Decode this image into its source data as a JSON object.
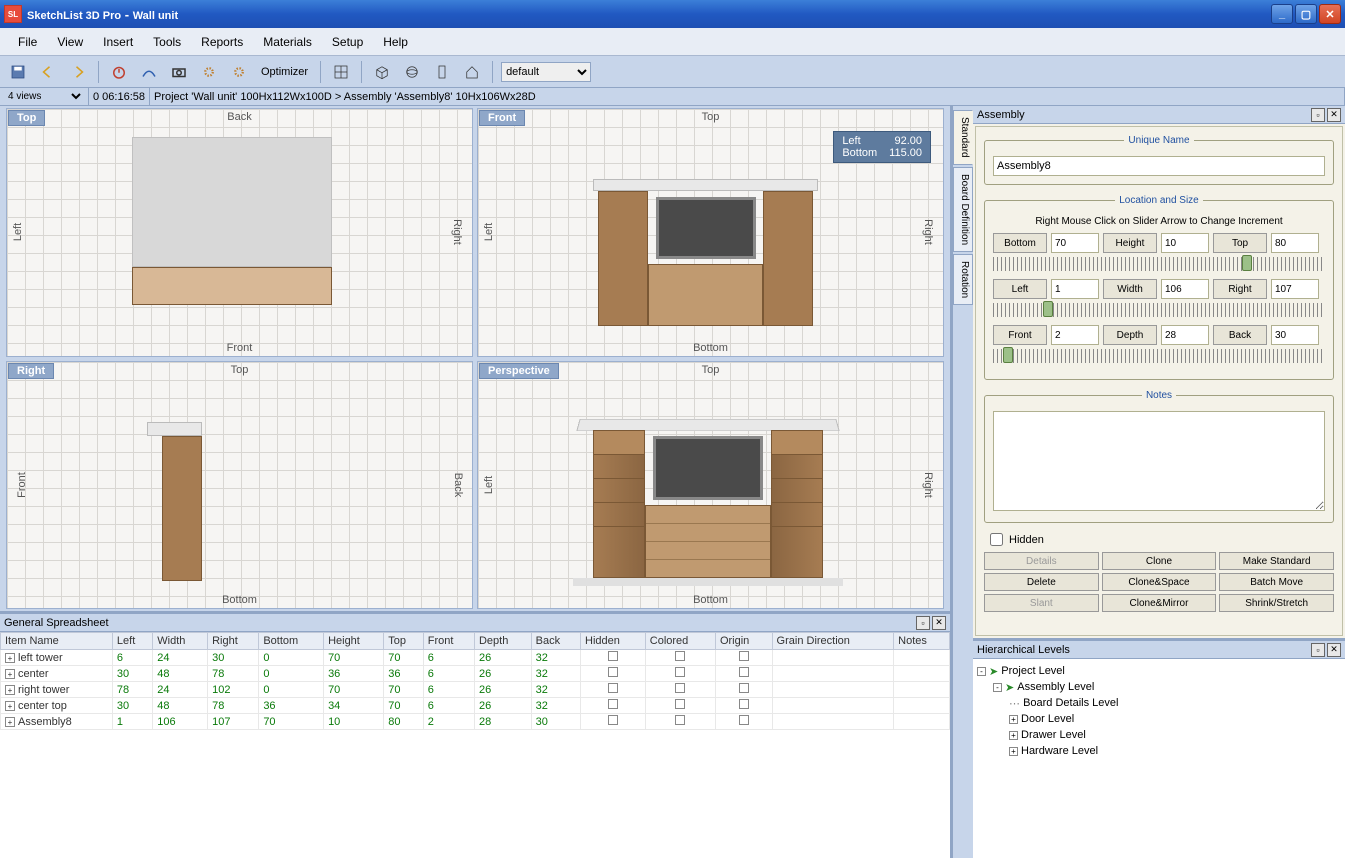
{
  "titlebar": {
    "app": "SketchList 3D Pro",
    "doc": "Wall unit"
  },
  "menubar": [
    "File",
    "View",
    "Insert",
    "Tools",
    "Reports",
    "Materials",
    "Setup",
    "Help"
  ],
  "toolbar": {
    "optimizer": "Optimizer",
    "preset": "default"
  },
  "statusbar": {
    "views": "4 views",
    "time": "0 06:16:58",
    "breadcrumb": "Project 'Wall unit' 100Hx112Wx100D > Assembly 'Assembly8' 10Hx106Wx28D"
  },
  "viewports": [
    {
      "tag": "Top",
      "top": "Back",
      "bottom": "Front",
      "left": "Left",
      "right": "Right"
    },
    {
      "tag": "Front",
      "top": "Top",
      "bottom": "Bottom",
      "left": "Left",
      "right": "Right",
      "overlay": {
        "l1a": "Left",
        "l1b": "92.00",
        "l2a": "Bottom",
        "l2b": "115.00"
      }
    },
    {
      "tag": "Right",
      "top": "Top",
      "bottom": "Bottom",
      "left": "Front",
      "right": "Back"
    },
    {
      "tag": "Perspective",
      "top": "Top",
      "bottom": "Bottom",
      "left": "Left",
      "right": "Right"
    }
  ],
  "spreadsheet": {
    "title": "General Spreadsheet",
    "headers": [
      "Item Name",
      "Left",
      "Width",
      "Right",
      "Bottom",
      "Height",
      "Top",
      "Front",
      "Depth",
      "Back",
      "Hidden",
      "Colored",
      "Origin",
      "Grain Direction",
      "Notes"
    ],
    "rows": [
      {
        "name": "left tower",
        "vals": [
          "6",
          "24",
          "30",
          "0",
          "70",
          "70",
          "6",
          "26",
          "32"
        ]
      },
      {
        "name": "center",
        "vals": [
          "30",
          "48",
          "78",
          "0",
          "36",
          "36",
          "6",
          "26",
          "32"
        ]
      },
      {
        "name": "right tower",
        "vals": [
          "78",
          "24",
          "102",
          "0",
          "70",
          "70",
          "6",
          "26",
          "32"
        ]
      },
      {
        "name": "center top",
        "vals": [
          "30",
          "48",
          "78",
          "36",
          "34",
          "70",
          "6",
          "26",
          "32"
        ]
      },
      {
        "name": "Assembly8",
        "vals": [
          "1",
          "106",
          "107",
          "70",
          "10",
          "80",
          "2",
          "28",
          "30"
        ]
      }
    ]
  },
  "side_tabs": [
    "Standard",
    "Board Definition",
    "Rotation"
  ],
  "assembly": {
    "title": "Assembly",
    "fs_name": "Unique Name",
    "name_value": "Assembly8",
    "fs_loc": "Location and Size",
    "hint": "Right Mouse Click on Slider Arrow to Change Increment",
    "row1": {
      "b1": "Bottom",
      "v1": "70",
      "b2": "Height",
      "v2": "10",
      "b3": "Top",
      "v3": "80"
    },
    "row2": {
      "b1": "Left",
      "v1": "1",
      "b2": "Width",
      "v2": "106",
      "b3": "Right",
      "v3": "107"
    },
    "row3": {
      "b1": "Front",
      "v1": "2",
      "b2": "Depth",
      "v2": "28",
      "b3": "Back",
      "v3": "30"
    },
    "fs_notes": "Notes",
    "hidden_label": "Hidden",
    "buttons": [
      "Details",
      "Clone",
      "Make Standard",
      "Delete",
      "Clone&Space",
      "Batch Move",
      "Slant",
      "Clone&Mirror",
      "Shrink/Stretch"
    ]
  },
  "hier": {
    "title": "Hierarchical Levels",
    "nodes": [
      "Project Level",
      "Assembly Level",
      "Board Details Level",
      "Door Level",
      "Drawer Level",
      "Hardware Level"
    ]
  }
}
